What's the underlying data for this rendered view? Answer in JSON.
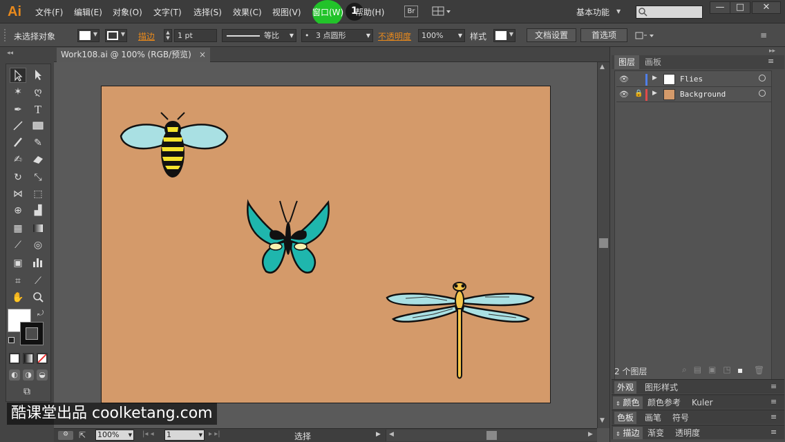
{
  "app": {
    "logo": "Ai"
  },
  "menu": {
    "file": "文件(F)",
    "edit": "编辑(E)",
    "object": "对象(O)",
    "type": "文字(T)",
    "select": "选择(S)",
    "effect": "效果(C)",
    "view": "视图(V)",
    "window": "窗口(W)",
    "help": "帮助(H)",
    "bridge": "Br",
    "workspace": "基本功能",
    "step_marker": "1"
  },
  "control": {
    "no_selection": "未选择对象",
    "stroke_label": "描边",
    "stroke_weight": "1 pt",
    "stroke_profile": "等比",
    "brush": "3 点圆形",
    "opacity_label": "不透明度",
    "opacity_value": "100%",
    "style_label": "样式",
    "doc_setup": "文档设置",
    "preferences": "首选项"
  },
  "document": {
    "tab_title": "Work108.ai @ 100% (RGB/预览)"
  },
  "panels": {
    "layers_tab": "图层",
    "artboards_tab": "画板",
    "layers": [
      {
        "name": "Flies",
        "color": "#4f7fe8"
      },
      {
        "name": "Background",
        "color": "#e04a4a"
      }
    ],
    "layer_count": "2 个图层",
    "appearance": "外观",
    "graphic_styles": "图形样式",
    "color": "颜色",
    "color_guide": "颜色参考",
    "kuler": "Kuler",
    "swatches": "色板",
    "brushes": "画笔",
    "symbols": "符号",
    "stroke": "描边",
    "gradient": "渐变",
    "transparency": "透明度"
  },
  "status": {
    "zoom": "100%",
    "artboard_num": "1",
    "tool": "选择"
  },
  "watermark": "酷课堂出品 coolketang.com",
  "colors": {
    "artboard": "#d49a6a",
    "accent": "#e8891c",
    "highlight": "#22c32a"
  }
}
